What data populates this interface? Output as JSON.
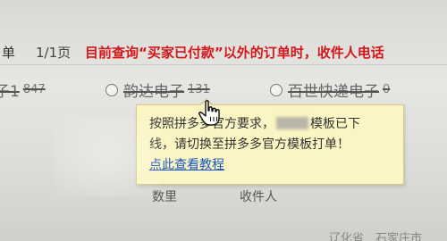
{
  "toolbar": {
    "order_label": "单",
    "page_info": "1/1页",
    "notice": "目前查询“买家已付款”以外的订单时，收件人电话"
  },
  "templates": [
    {
      "label": "子1",
      "count": "847"
    },
    {
      "label": "韵达电子",
      "count": "131"
    },
    {
      "label": "百世快递电子",
      "count": "0"
    }
  ],
  "tooltip": {
    "line1_pre": "按照拼多多官方要求，",
    "line1_post": "模板已下",
    "line2": "线，请切换至拼多多官方模板打单！",
    "link": "点此查看教程"
  },
  "table_header": {
    "col_a": "数里",
    "col_b": "收件人"
  },
  "bottom": {
    "left": "",
    "right_a": "辽化省",
    "right_b": "石家庄市"
  },
  "colors": {
    "notice": "#d3171b",
    "tooltip_bg": "#fbf5c3",
    "link": "#1a56c2"
  },
  "icons": {
    "cursor": "hand-pointer-icon",
    "radio": "radio-button-icon"
  }
}
